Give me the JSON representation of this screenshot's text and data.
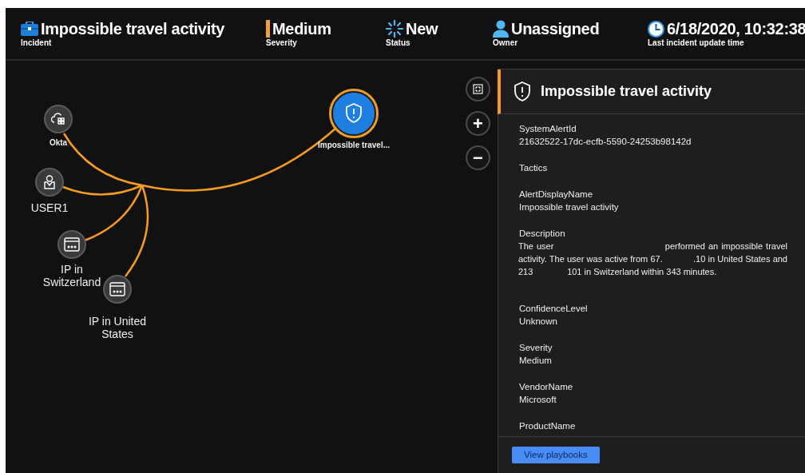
{
  "header": {
    "items": [
      {
        "kind": "incident",
        "value": "Impossible travel activity",
        "label": "Incident"
      },
      {
        "kind": "severity",
        "value": "Medium",
        "label": "Severity"
      },
      {
        "kind": "status",
        "value": "New",
        "label": "Status"
      },
      {
        "kind": "owner",
        "value": "Unassigned",
        "label": "Owner"
      },
      {
        "kind": "time",
        "value": "6/18/2020, 10:32:38",
        "label": "Last incident update time"
      }
    ]
  },
  "graph": {
    "nodes": [
      {
        "kind": "cloud-app",
        "label": "Okta",
        "selected": false
      },
      {
        "kind": "account",
        "label": "USER1",
        "selected": false
      },
      {
        "kind": "ip",
        "label": "IP in Switzerland",
        "selected": false
      },
      {
        "kind": "ip",
        "label": "IP in United States",
        "selected": false
      },
      {
        "kind": "alert",
        "label": "Impossible travel...",
        "selected": true
      }
    ],
    "controls": [
      {
        "kind": "fit"
      },
      {
        "kind": "zoom-in",
        "label": "+"
      },
      {
        "kind": "zoom-out",
        "label": "−"
      }
    ]
  },
  "details": {
    "title": "Impossible travel activity",
    "fields": [
      {
        "name": "SystemAlertId",
        "value": "21632522-17dc-ecfb-5590-24253b98142d"
      },
      {
        "name": "Tactics"
      },
      {
        "name": "AlertDisplayName",
        "value": "Impossible travel activity"
      },
      {
        "name": "Description",
        "value": "The user                                   performed an impossible travel activity. The user was active from 67.            .10 in United States and 213              101 in Switzerland within 343 minutes.",
        "kind": "paragraph"
      },
      {
        "name": "ConfidenceLevel",
        "value": "Unknown"
      },
      {
        "name": "Severity",
        "value": "Medium"
      },
      {
        "name": "VendorName",
        "value": "Microsoft"
      },
      {
        "name": "ProductName"
      }
    ],
    "button": "View playbooks"
  }
}
